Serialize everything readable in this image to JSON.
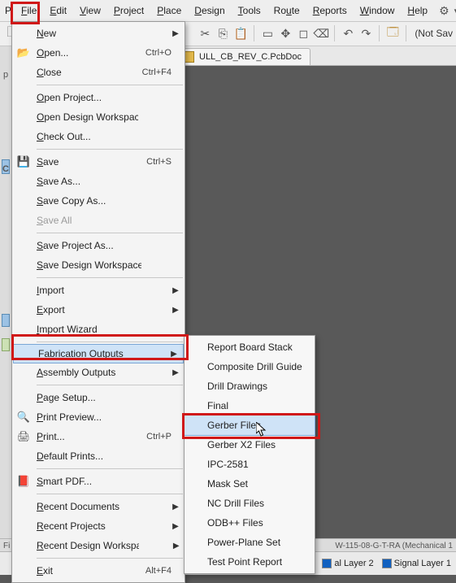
{
  "menubar": {
    "items": [
      {
        "label": "File",
        "u": 0
      },
      {
        "label": "Edit",
        "u": 0
      },
      {
        "label": "View",
        "u": 0
      },
      {
        "label": "Project",
        "u": 0
      },
      {
        "label": "Place",
        "u": 0
      },
      {
        "label": "Design",
        "u": 0
      },
      {
        "label": "Tools",
        "u": 0
      },
      {
        "label": "Route",
        "u": 3
      },
      {
        "label": "Reports",
        "u": 0
      },
      {
        "label": "Window",
        "u": 0
      },
      {
        "label": "Help",
        "u": 0
      }
    ]
  },
  "toolbar": {
    "not_saved": "(Not Sav"
  },
  "tab": {
    "title": "ULL_CB_REV_C.PcbDoc"
  },
  "file_menu": {
    "items": [
      {
        "label": "New",
        "arrow": true
      },
      {
        "label": "Open...",
        "shortcut": "Ctrl+O",
        "icon": "open"
      },
      {
        "label": "Close",
        "shortcut": "Ctrl+F4"
      },
      {
        "sep": true
      },
      {
        "label": "Open Project..."
      },
      {
        "label": "Open Design Workspace..."
      },
      {
        "label": "Check Out..."
      },
      {
        "sep": true
      },
      {
        "label": "Save",
        "shortcut": "Ctrl+S",
        "icon": "save"
      },
      {
        "label": "Save As..."
      },
      {
        "label": "Save Copy As..."
      },
      {
        "label": "Save All",
        "disabled": true
      },
      {
        "sep": true
      },
      {
        "label": "Save Project As..."
      },
      {
        "label": "Save Design Workspace As..."
      },
      {
        "sep": true
      },
      {
        "label": "Import",
        "arrow": true
      },
      {
        "label": "Export",
        "arrow": true
      },
      {
        "label": "Import Wizard"
      },
      {
        "sep": true
      },
      {
        "label": "Fabrication Outputs",
        "arrow": true,
        "highlight": true
      },
      {
        "label": "Assembly Outputs",
        "arrow": true
      },
      {
        "sep": true
      },
      {
        "label": "Page Setup..."
      },
      {
        "label": "Print Preview...",
        "icon": "preview"
      },
      {
        "label": "Print...",
        "shortcut": "Ctrl+P",
        "icon": "print"
      },
      {
        "label": "Default Prints..."
      },
      {
        "sep": true
      },
      {
        "label": "Smart PDF...",
        "icon": "pdf"
      },
      {
        "sep": true
      },
      {
        "label": "Recent Documents",
        "arrow": true
      },
      {
        "label": "Recent Projects",
        "arrow": true
      },
      {
        "label": "Recent Design Workspaces",
        "arrow": true
      },
      {
        "sep": true
      },
      {
        "label": "Exit",
        "shortcut": "Alt+F4"
      }
    ]
  },
  "submenu": {
    "items": [
      {
        "label": "Report Board Stack"
      },
      {
        "label": "Composite Drill Guide"
      },
      {
        "label": "Drill Drawings"
      },
      {
        "label": "Final"
      },
      {
        "label": "Gerber Files",
        "highlight": true
      },
      {
        "label": "Gerber X2 Files"
      },
      {
        "label": "IPC-2581"
      },
      {
        "label": "Mask Set"
      },
      {
        "label": "NC Drill Files"
      },
      {
        "label": "ODB++ Files"
      },
      {
        "label": "Power-Plane Set"
      },
      {
        "label": "Test Point Report"
      }
    ]
  },
  "status": {
    "left_fi": "Fi",
    "layer2": "al Layer 2",
    "layer1": "Signal Layer 1",
    "footer_right": "W-115-08-G-T-RA (Mechanical 1"
  },
  "leftstrip": {
    "p": "p",
    "c": "C"
  }
}
